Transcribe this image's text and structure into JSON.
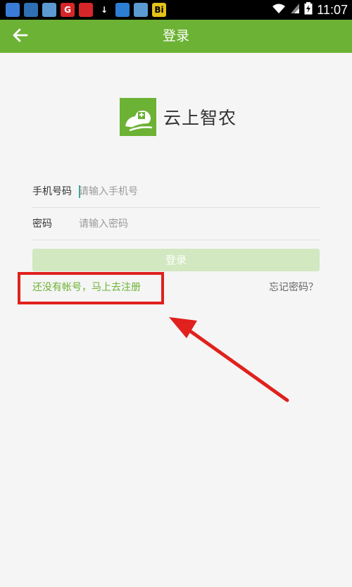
{
  "status_bar": {
    "time": "11:07",
    "notification_icons": [
      {
        "icon": "app-icon",
        "label": "",
        "color": "#3a7bd5"
      },
      {
        "icon": "app-icon",
        "label": "",
        "color": "#2f6fb3"
      },
      {
        "icon": "app-icon",
        "label": "",
        "color": "#5c9bd1"
      },
      {
        "icon": "app-icon",
        "label": "G",
        "color": "#d7262a"
      },
      {
        "icon": "app-icon",
        "label": "",
        "color": "#d7262a"
      },
      {
        "icon": "download-icon",
        "label": "↓",
        "color": "#000000"
      },
      {
        "icon": "app-icon",
        "label": "",
        "color": "#2d7fd6"
      },
      {
        "icon": "app-icon",
        "label": "",
        "color": "#5c9bd1"
      },
      {
        "icon": "app-icon",
        "label": "Bi",
        "color": "#e5c21a"
      }
    ]
  },
  "header": {
    "title": "登录"
  },
  "logo": {
    "app_name": "云上智农"
  },
  "form": {
    "phone": {
      "label": "手机号码",
      "placeholder": "请输入手机号",
      "value": ""
    },
    "password": {
      "label": "密码",
      "placeholder": "请输入密码",
      "value": ""
    }
  },
  "login_button_label": "登录",
  "links": {
    "register": "还没有帐号，马上去注册",
    "forgot_password": "忘记密码？"
  },
  "colors": {
    "brand_green": "#6cb234",
    "annotation_red": "#e0211d",
    "login_button_disabled": "#d2e8c0"
  }
}
